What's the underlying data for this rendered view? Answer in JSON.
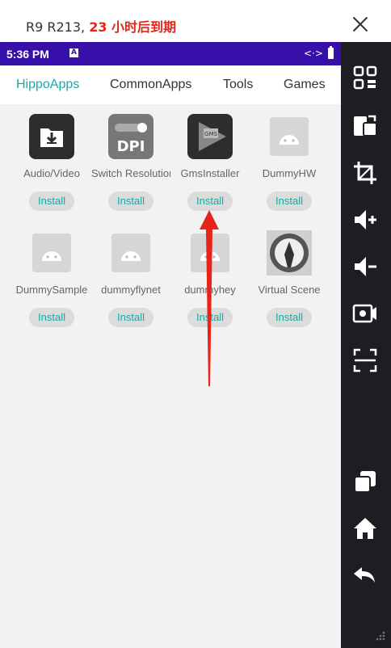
{
  "window": {
    "title_prefix": "R9 R213, ",
    "title_highlight": "23 小时后到期"
  },
  "statusbar": {
    "time": "5:36 PM",
    "notification_icon": "A",
    "data_icon": "<·>"
  },
  "tabs": [
    {
      "label": "HippoApps",
      "active": true
    },
    {
      "label": "CommonApps",
      "active": false
    },
    {
      "label": "Tools",
      "active": false
    },
    {
      "label": "Games",
      "active": false
    }
  ],
  "apps": [
    {
      "name": "Audio/Video",
      "button": "Install",
      "icon": "download-folder-icon"
    },
    {
      "name": "Switch Resolution",
      "button": "Install",
      "icon": "dpi-icon"
    },
    {
      "name": "GmsInstaller",
      "button": "Install",
      "icon": "gms-play-icon"
    },
    {
      "name": "DummyHW",
      "button": "Install",
      "icon": "android-icon"
    },
    {
      "name": "DummySample",
      "button": "Install",
      "icon": "android-icon"
    },
    {
      "name": "dummyflynet",
      "button": "Install",
      "icon": "android-icon"
    },
    {
      "name": "dummyhey",
      "button": "Install",
      "icon": "android-icon"
    },
    {
      "name": "Virtual Scene",
      "button": "Install",
      "icon": "virtual-scene-icon"
    }
  ],
  "sidebar": {
    "icons": [
      "grid-icon",
      "rotate-screen-icon",
      "crop-icon",
      "volume-up-icon",
      "volume-down-icon",
      "record-icon",
      "scan-icon",
      "copy-icon",
      "home-icon",
      "back-icon",
      "resize-grip-icon"
    ]
  },
  "colors": {
    "accent": "#1aa9a0",
    "statusbar": "#3610a8",
    "highlight": "#e0271a",
    "sidebar": "#1d1e24",
    "annotation_arrow": "#e8231a"
  }
}
